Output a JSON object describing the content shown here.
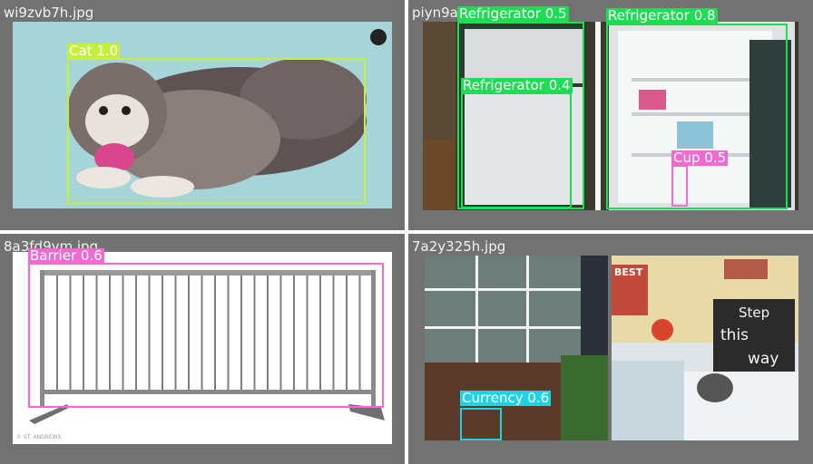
{
  "tiles": [
    {
      "filename": "wi9zvb7h.jpg",
      "detections": [
        {
          "label": "Cat 1.0",
          "color": "#c4f03c"
        }
      ]
    },
    {
      "filename": "piyn9a",
      "detections": [
        {
          "label": "Refrigerator 0.5",
          "color": "#1fdc55"
        },
        {
          "label": "Refrigerator 0.8",
          "color": "#1fdc55"
        },
        {
          "label": "Refrigerator 0.4",
          "color": "#1fdc55"
        },
        {
          "label": "Cup 0.5",
          "color": "#f06ad2"
        }
      ]
    },
    {
      "filename": "8a3fd9ym.jpg",
      "detections": [
        {
          "label": "Barrier 0.6",
          "color": "#f06ad2"
        }
      ],
      "watermark": "© ST. ANDREWS"
    },
    {
      "filename": "7a2y325h.jpg",
      "detections": [
        {
          "label": "Currency 0.6",
          "color": "#1ed3e6"
        }
      ],
      "sign_text": [
        "Step",
        "this",
        "way"
      ],
      "poster_text": "BEST"
    }
  ]
}
